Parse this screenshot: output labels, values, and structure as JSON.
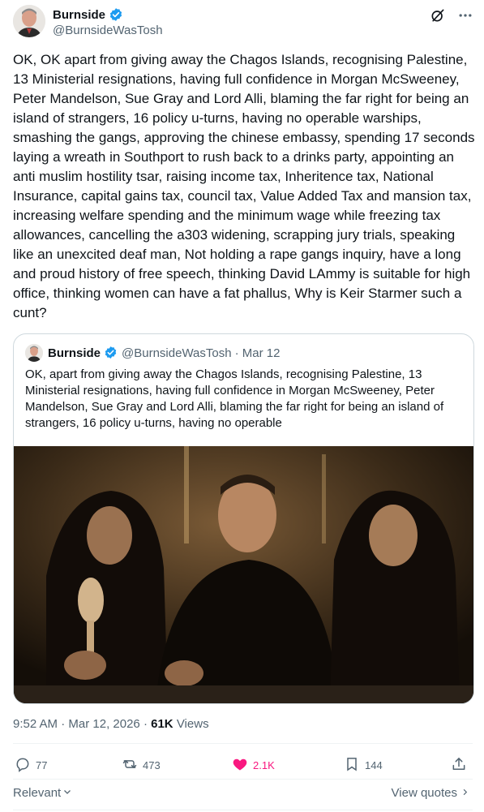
{
  "author": {
    "name": "Burnside",
    "handle": "@BurnsideWasTosh"
  },
  "tweet": {
    "text": "OK, OK apart from giving away the Chagos Islands, recognising Palestine, 13 Ministerial resignations, having full confidence in Morgan McSweeney, Peter Mandelson, Sue Gray and Lord Alli, blaming the far right for being an island of strangers, 16 policy u-turns, having no operable warships, smashing the gangs, approving the chinese embassy, spending 17 seconds laying a wreath in Southport to rush back to a drinks party, appointing an anti muslim hostility tsar, raising income tax, Inheritence tax, National Insurance, capital gains tax, council tax, Value Added Tax and mansion tax, increasing welfare spending and the minimum wage while freezing tax allowances, cancelling the a303 widening, scrapping jury trials, speaking like an unexcited deaf man, Not holding a rape gangs inquiry, have a long and proud history of free speech, thinking David LAmmy is suitable for high office, thinking women can have a fat phallus, Why is Keir Starmer such a cunt?",
    "time": "9:52 AM",
    "date": "Mar 12, 2026",
    "separator": "·",
    "views_count": "61K",
    "views_label": "Views"
  },
  "quoted": {
    "name": "Burnside",
    "handle": "@BurnsideWasTosh",
    "date": "· Mar 12",
    "text": "OK, apart from giving away the Chagos Islands, recognising Palestine, 13 Ministerial resignations, having full confidence in Morgan McSweeney, Peter Mandelson, Sue Gray and Lord Alli, blaming the far right for being an island of strangers, 16 policy u-turns, having no operable"
  },
  "actions": {
    "replies": "77",
    "reposts": "473",
    "likes": "2.1K",
    "bookmarks": "144"
  },
  "footer": {
    "relevant": "Relevant",
    "view_quotes": "View quotes"
  },
  "colors": {
    "accent": "#1d9bf0",
    "like": "#f91880",
    "muted": "#536471",
    "text": "#0f1419"
  }
}
